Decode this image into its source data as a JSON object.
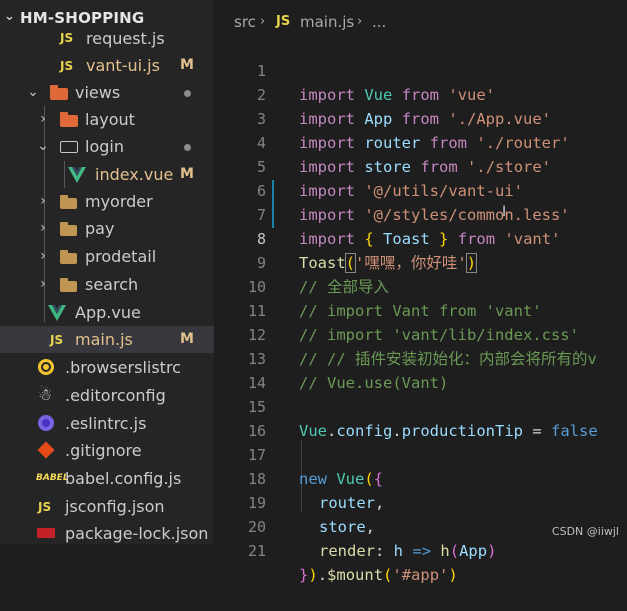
{
  "explorer": {
    "project": "HM-SHOPPING",
    "items": [
      {
        "label": "request.js",
        "badge": "",
        "icon": "js-file-icon"
      },
      {
        "label": "vant-ui.js",
        "badge": "M",
        "icon": "js-file-icon"
      },
      {
        "label": "views",
        "badge": "",
        "icon": "views-folder-icon"
      },
      {
        "label": "layout",
        "badge": "",
        "icon": "folder-icon"
      },
      {
        "label": "login",
        "badge": "",
        "icon": "folder-open-icon"
      },
      {
        "label": "index.vue",
        "badge": "M",
        "icon": "vue-file-icon"
      },
      {
        "label": "myorder",
        "badge": "",
        "icon": "folder-icon"
      },
      {
        "label": "pay",
        "badge": "",
        "icon": "folder-icon"
      },
      {
        "label": "prodetail",
        "badge": "",
        "icon": "folder-icon"
      },
      {
        "label": "search",
        "badge": "",
        "icon": "folder-icon"
      },
      {
        "label": "App.vue",
        "badge": "",
        "icon": "vue-file-icon"
      },
      {
        "label": "main.js",
        "badge": "M",
        "icon": "js-file-icon"
      },
      {
        "label": ".browserslistrc",
        "badge": "",
        "icon": "browserslist-icon"
      },
      {
        "label": ".editorconfig",
        "badge": "",
        "icon": "editorconfig-icon"
      },
      {
        "label": ".eslintrc.js",
        "badge": "",
        "icon": "eslint-icon"
      },
      {
        "label": ".gitignore",
        "badge": "",
        "icon": "git-icon"
      },
      {
        "label": "babel.config.js",
        "badge": "",
        "icon": "babel-icon"
      },
      {
        "label": "jsconfig.json",
        "badge": "",
        "icon": "js-file-icon"
      },
      {
        "label": "package-lock.json",
        "badge": "",
        "icon": "npm-icon"
      }
    ],
    "js_icon_text": "JS",
    "colors": {
      "modified": "#e2c08d",
      "selected_row": "#37373d"
    }
  },
  "editor": {
    "breadcrumb": {
      "folder": "src",
      "file_icon_text": "JS",
      "file": "main.js",
      "more": "..."
    },
    "line_numbers": [
      "1",
      "2",
      "3",
      "4",
      "5",
      "6",
      "7",
      "8",
      "9",
      "10",
      "11",
      "12",
      "13",
      "14",
      "15",
      "16",
      "17",
      "18",
      "19",
      "20",
      "21"
    ],
    "current_line": "8",
    "lines": {
      "l1": [
        "import",
        " ",
        "Vue",
        " ",
        "from",
        " ",
        "'vue'"
      ],
      "l2": [
        "import",
        " ",
        "App",
        " ",
        "from",
        " ",
        "'./App.vue'"
      ],
      "l3": [
        "import",
        " ",
        "router",
        " ",
        "from",
        " ",
        "'./router'"
      ],
      "l4": [
        "import",
        " ",
        "store",
        " ",
        "from",
        " ",
        "'./store'"
      ],
      "l5": [
        "import",
        " ",
        "'@/utils/vant-ui'"
      ],
      "l6": [
        "import",
        " ",
        "'@/styles/common.less'"
      ],
      "l7": [
        "import",
        " ",
        "{",
        " ",
        "Toast",
        " ",
        "}",
        " ",
        "from",
        " ",
        "'vant'"
      ],
      "l8": [
        "Toast",
        "(",
        "'嘿嘿，你好哇'",
        ")"
      ],
      "l9": "// 全部导入",
      "l10": "// import Vant from 'vant'",
      "l11": "// import 'vant/lib/index.css'",
      "l12": "// // 插件安装初始化：内部会将所有的v",
      "l13": "// Vue.use(Vant)",
      "l15": [
        "Vue",
        ".",
        "config",
        ".",
        "productionTip",
        " = ",
        "false"
      ],
      "l17": [
        "new",
        " ",
        "Vue",
        "(",
        "{"
      ],
      "l18": [
        "router",
        ","
      ],
      "l19": [
        "store",
        ","
      ],
      "l20": [
        "render",
        ": ",
        "h",
        " ",
        "=>",
        " ",
        "h",
        "(",
        "App",
        ")"
      ],
      "l21": [
        "}",
        ")",
        ".",
        "$mount",
        "(",
        "'#app'",
        ")"
      ]
    }
  },
  "watermark": "CSDN @iiwjl",
  "ibeam": "I"
}
